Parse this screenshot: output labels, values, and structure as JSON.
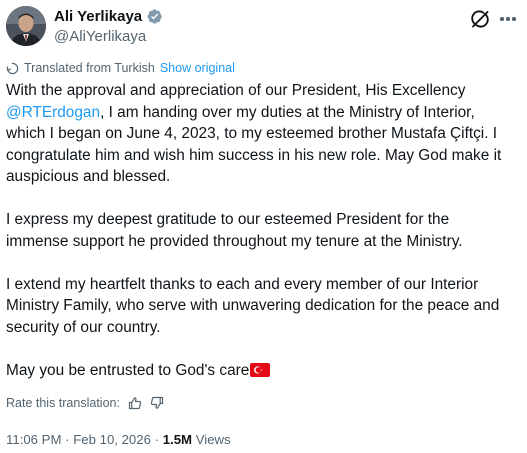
{
  "author": {
    "display_name": "Ali Yerlikaya",
    "handle": "@AliYerlikaya",
    "verified_badge_color": "#829aab"
  },
  "translation": {
    "label": "Translated from Turkish",
    "show_original": "Show original",
    "rate_label": "Rate this translation:"
  },
  "tweet": {
    "line_01a": "With the approval and appreciation of our President, His Excellency",
    "line_02_mention": "@RTErdogan",
    "line_02b": ", I am handing over my duties at the Ministry of Interior,",
    "line_03": "which I began on June 4, 2023, to my esteemed brother Mustafa Çiftçi. I",
    "line_04": "congratulate him and wish him success in his new role. May God make it",
    "line_05": "auspicious and blessed.",
    "line_07": "I express my deepest gratitude to our esteemed President for the",
    "line_08": "immense support he provided throughout my tenure at the Ministry.",
    "line_10": "I extend my heartfelt thanks to each and every member of our Interior",
    "line_11": "Ministry Family, who serve with unwavering dedication for the peace and",
    "line_12": "security of our country.",
    "line_14": "May you be entrusted to God's care",
    "emoji": "turkey-flag"
  },
  "meta": {
    "time": "11:06 PM",
    "separator": "·",
    "date": "Feb 10, 2026",
    "views_count": "1.5M",
    "views_label": "Views"
  },
  "colors": {
    "text": "#0f1419",
    "secondary": "#536471",
    "link": "#1d9bf0"
  }
}
